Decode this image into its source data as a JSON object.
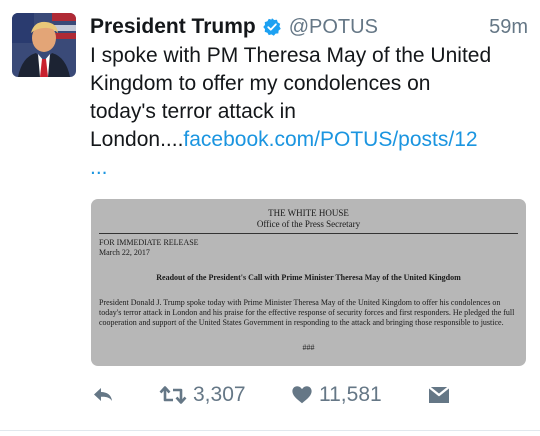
{
  "tweet": {
    "author_name": "President Trump",
    "handle": "@POTUS",
    "time": "59m",
    "text_lines": [
      "I spoke with PM Theresa May of the United",
      "Kingdom to offer my condolences on",
      "today's terror attack in"
    ],
    "text_last_prefix": "London....",
    "link_text": "facebook.com/POTUS/posts/12",
    "ellipsis": "...",
    "verified_icon": "verified-icon",
    "avatar_icon": "avatar-icon"
  },
  "media": {
    "org": "THE WHITE HOUSE",
    "office": "Office of the Press Secretary",
    "release": "FOR IMMEDIATE RELEASE",
    "date": "March 22, 2017",
    "title": "Readout of the President's Call with Prime Minister Theresa May of the United Kingdom",
    "body": "President Donald J. Trump spoke today with Prime Minister Theresa May of the United Kingdom to offer his condolences on today's terror attack in London and his praise for the effective response of security forces and first responders. He pledged the full cooperation and support of the United States Government in responding to the attack and bringing those responsible to justice.",
    "end_mark": "###"
  },
  "actions": {
    "reply_icon": "reply-icon",
    "retweet_icon": "retweet-icon",
    "retweet_count": "3,307",
    "like_icon": "heart-icon",
    "like_count": "11,581",
    "dm_icon": "direct-message-icon"
  },
  "colors": {
    "link": "#1b95e0",
    "secondary_text": "#657786",
    "verified": "#1da1f2",
    "media_background": "#b7b7b7"
  }
}
